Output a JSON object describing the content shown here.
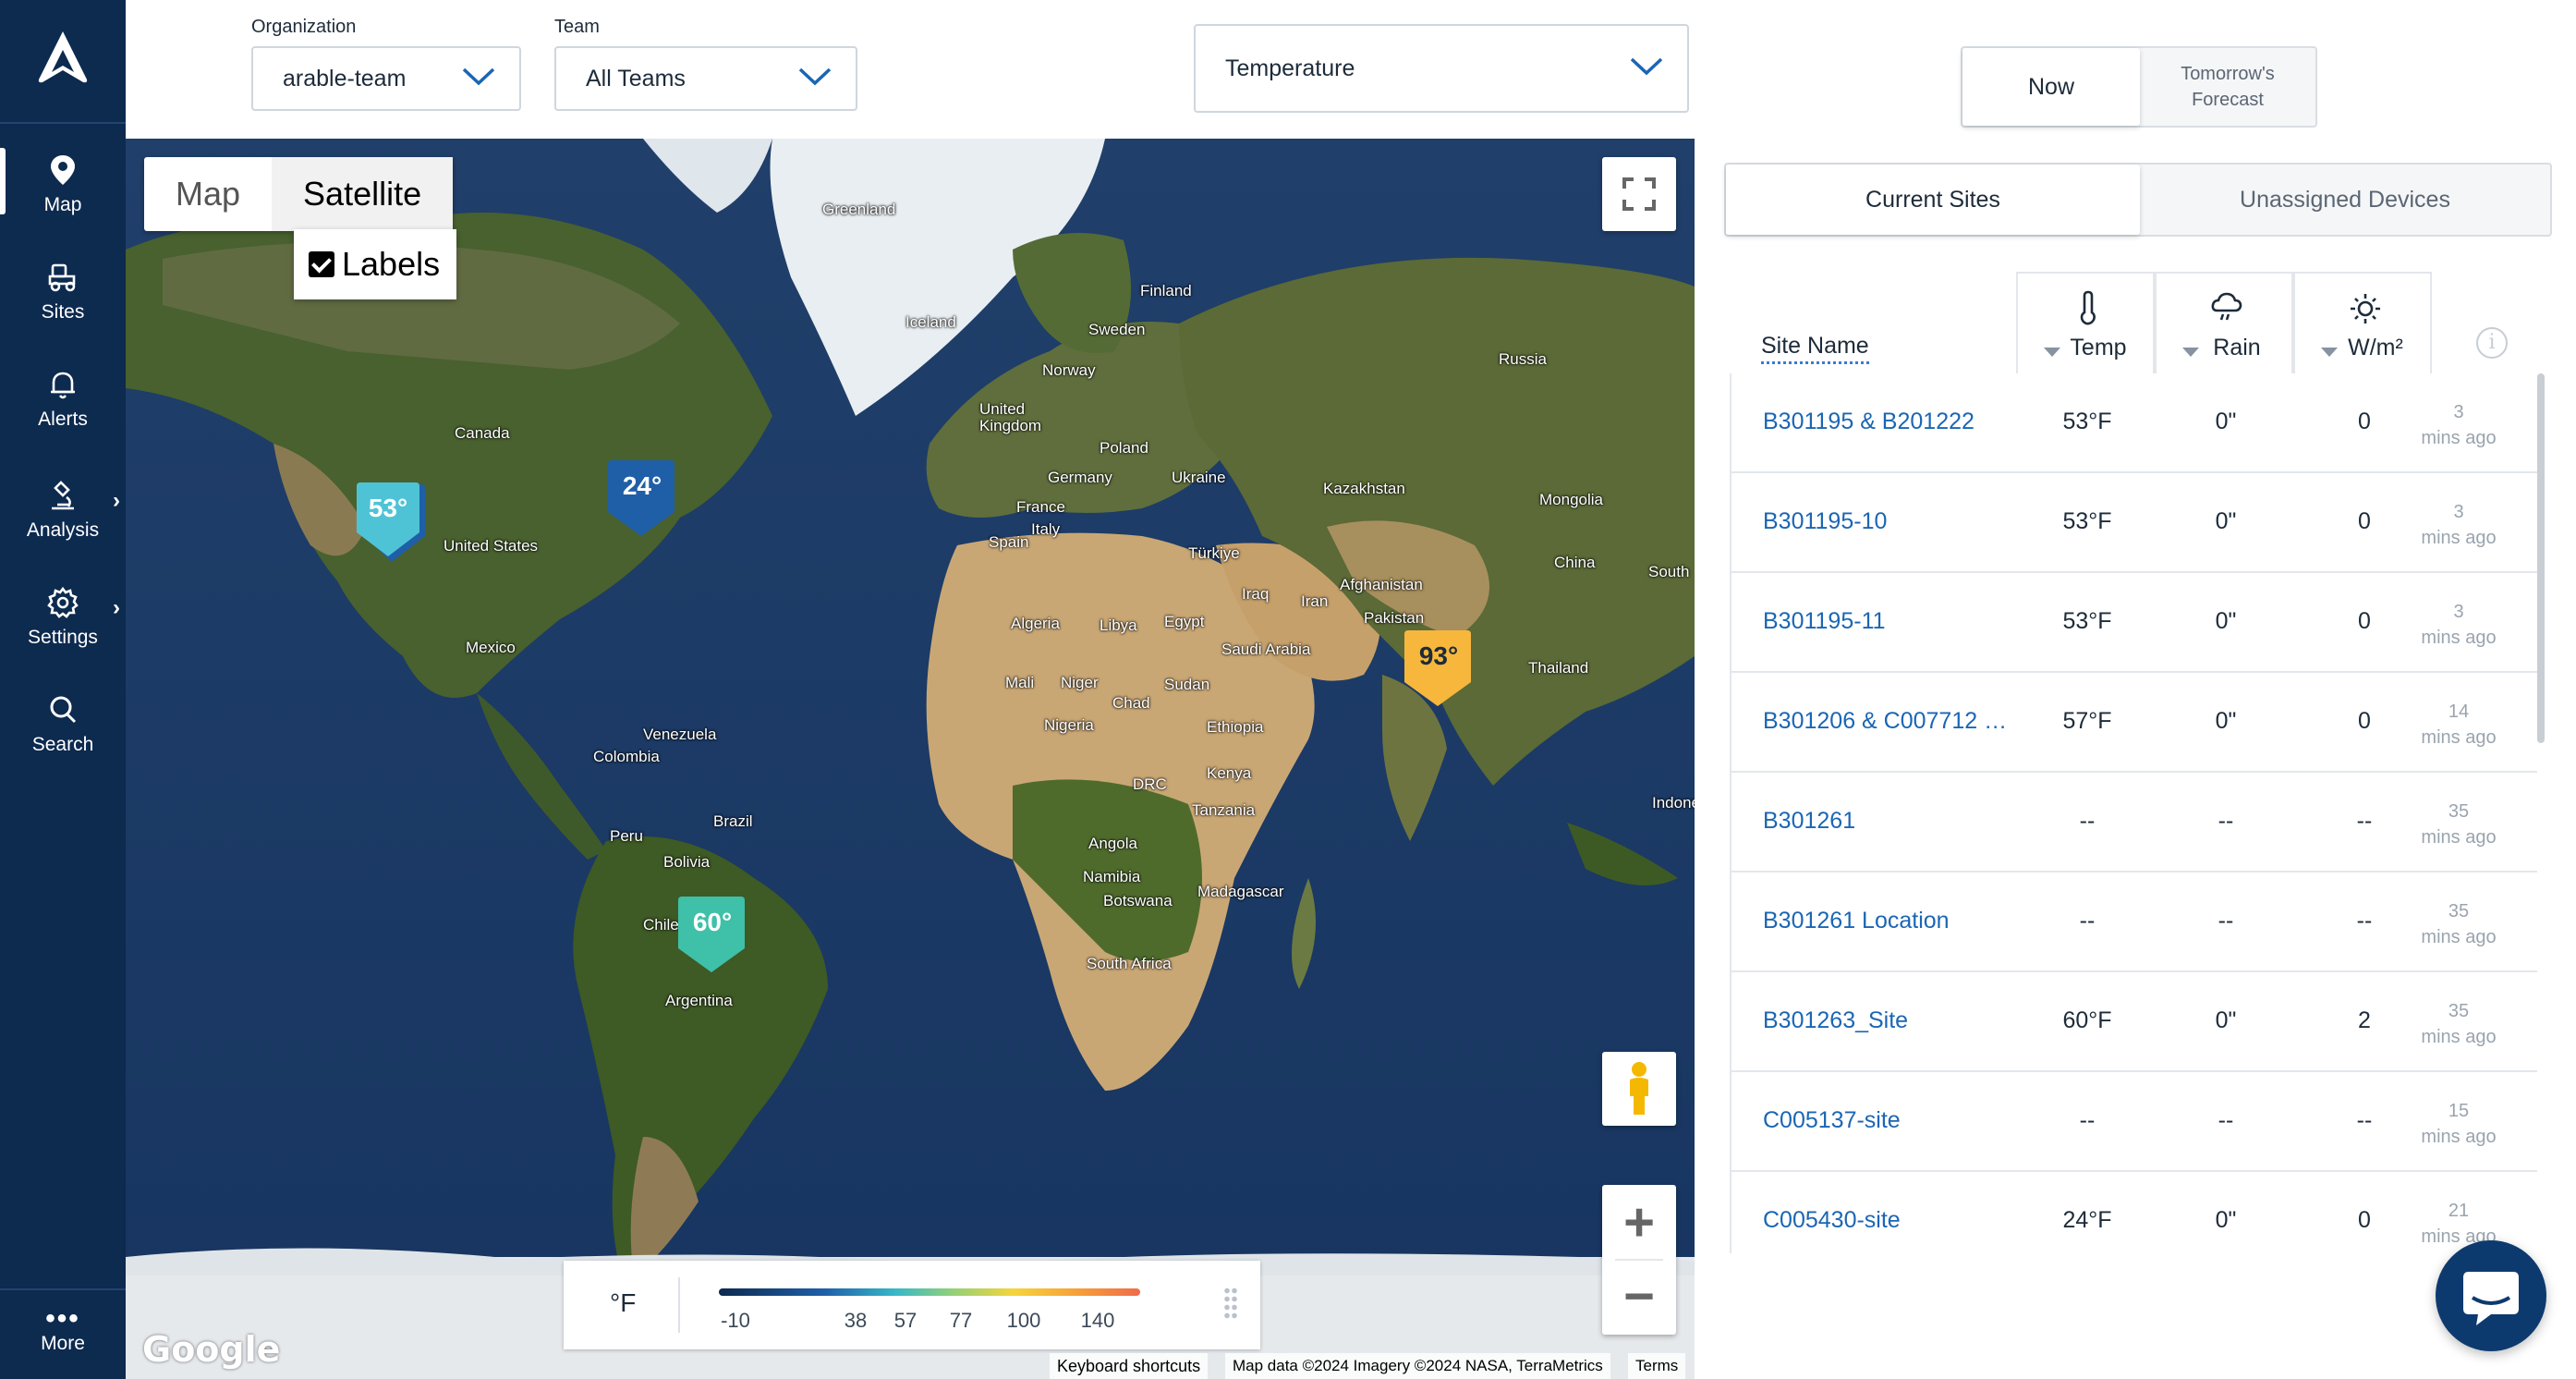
{
  "nav": {
    "items": [
      {
        "label": "Map",
        "icon": "map-pin-icon",
        "active": true
      },
      {
        "label": "Sites",
        "icon": "tractor-icon"
      },
      {
        "label": "Alerts",
        "icon": "bell-icon"
      },
      {
        "label": "Analysis",
        "icon": "microscope-icon",
        "has_submenu": true
      },
      {
        "label": "Settings",
        "icon": "gear-icon",
        "has_submenu": true
      },
      {
        "label": "Search",
        "icon": "search-icon"
      }
    ],
    "more_label": "More"
  },
  "filters": {
    "organization_label": "Organization",
    "organization_value": "arable-team",
    "team_label": "Team",
    "team_value": "All Teams",
    "metric_value": "Temperature"
  },
  "map": {
    "type_options": [
      "Map",
      "Satellite"
    ],
    "type_selected": "Satellite",
    "labels_checkbox": "Labels",
    "labels_checked": true,
    "pins": [
      {
        "value": "53°",
        "color": "#4fc3d6"
      },
      {
        "value": "24°",
        "color": "#1f5fa8"
      },
      {
        "value": "93°",
        "color": "#f6b73c"
      },
      {
        "value": "60°",
        "color": "#3fc0a8"
      }
    ],
    "place_labels": [
      "Greenland",
      "Iceland",
      "Finland",
      "Sweden",
      "Norway",
      "Russia",
      "Canada",
      "United Kingdom",
      "Poland",
      "Germany",
      "Ukraine",
      "France",
      "Kazakhstan",
      "Mongolia",
      "Italy",
      "Spain",
      "Türkiye",
      "China",
      "United States",
      "Iraq",
      "Iran",
      "Afghanistan",
      "South",
      "Algeria",
      "Libya",
      "Egypt",
      "Pakistan",
      "Saudi Arabia",
      "Mexico",
      "Thailand",
      "Mali",
      "Niger",
      "Sudan",
      "Chad",
      "Nigeria",
      "Ethiopia",
      "Venezuela",
      "Colombia",
      "Kenya",
      "DRC",
      "Tanzania",
      "Indonesia",
      "Brazil",
      "Peru",
      "Angola",
      "Bolivia",
      "Namibia",
      "Madagascar",
      "Botswana",
      "Chile",
      "South Africa",
      "Argentina"
    ],
    "legend": {
      "unit": "°F",
      "ticks": [
        "-10",
        "38",
        "57",
        "77",
        "100",
        "140"
      ]
    },
    "footer": {
      "keyboard": "Keyboard shortcuts",
      "attribution": "Map data ©2024 Imagery ©2024 NASA, TerraMetrics",
      "terms": "Terms",
      "logo": "Google"
    }
  },
  "panel": {
    "time_tabs": [
      "Now",
      "Tomorrow's Forecast"
    ],
    "time_selected": "Now",
    "site_tabs": [
      "Current Sites",
      "Unassigned Devices"
    ],
    "site_selected": "Current Sites",
    "columns": {
      "site": "Site Name",
      "temp": "Temp",
      "rain": "Rain",
      "solar": "W/m²"
    },
    "info_icon": "i",
    "rows": [
      {
        "site": "B301195 & B201222",
        "temp": "53°F",
        "rain": "0\"",
        "solar": "0",
        "ago_n": "3",
        "ago_u": "mins ago"
      },
      {
        "site": "B301195-10",
        "temp": "53°F",
        "rain": "0\"",
        "solar": "0",
        "ago_n": "3",
        "ago_u": "mins ago"
      },
      {
        "site": "B301195-11",
        "temp": "53°F",
        "rain": "0\"",
        "solar": "0",
        "ago_n": "3",
        "ago_u": "mins ago"
      },
      {
        "site": "B301206 & C007712 & ...",
        "temp": "57°F",
        "rain": "0\"",
        "solar": "0",
        "ago_n": "14",
        "ago_u": "mins ago"
      },
      {
        "site": "B301261",
        "temp": "--",
        "rain": "--",
        "solar": "--",
        "ago_n": "35",
        "ago_u": "mins ago"
      },
      {
        "site": "B301261 Location",
        "temp": "--",
        "rain": "--",
        "solar": "--",
        "ago_n": "35",
        "ago_u": "mins ago"
      },
      {
        "site": "B301263_Site",
        "temp": "60°F",
        "rain": "0\"",
        "solar": "2",
        "ago_n": "35",
        "ago_u": "mins ago"
      },
      {
        "site": "C005137-site",
        "temp": "--",
        "rain": "--",
        "solar": "--",
        "ago_n": "15",
        "ago_u": "mins ago"
      },
      {
        "site": "C005430-site",
        "temp": "24°F",
        "rain": "0\"",
        "solar": "0",
        "ago_n": "21",
        "ago_u": "mins ago"
      }
    ]
  }
}
